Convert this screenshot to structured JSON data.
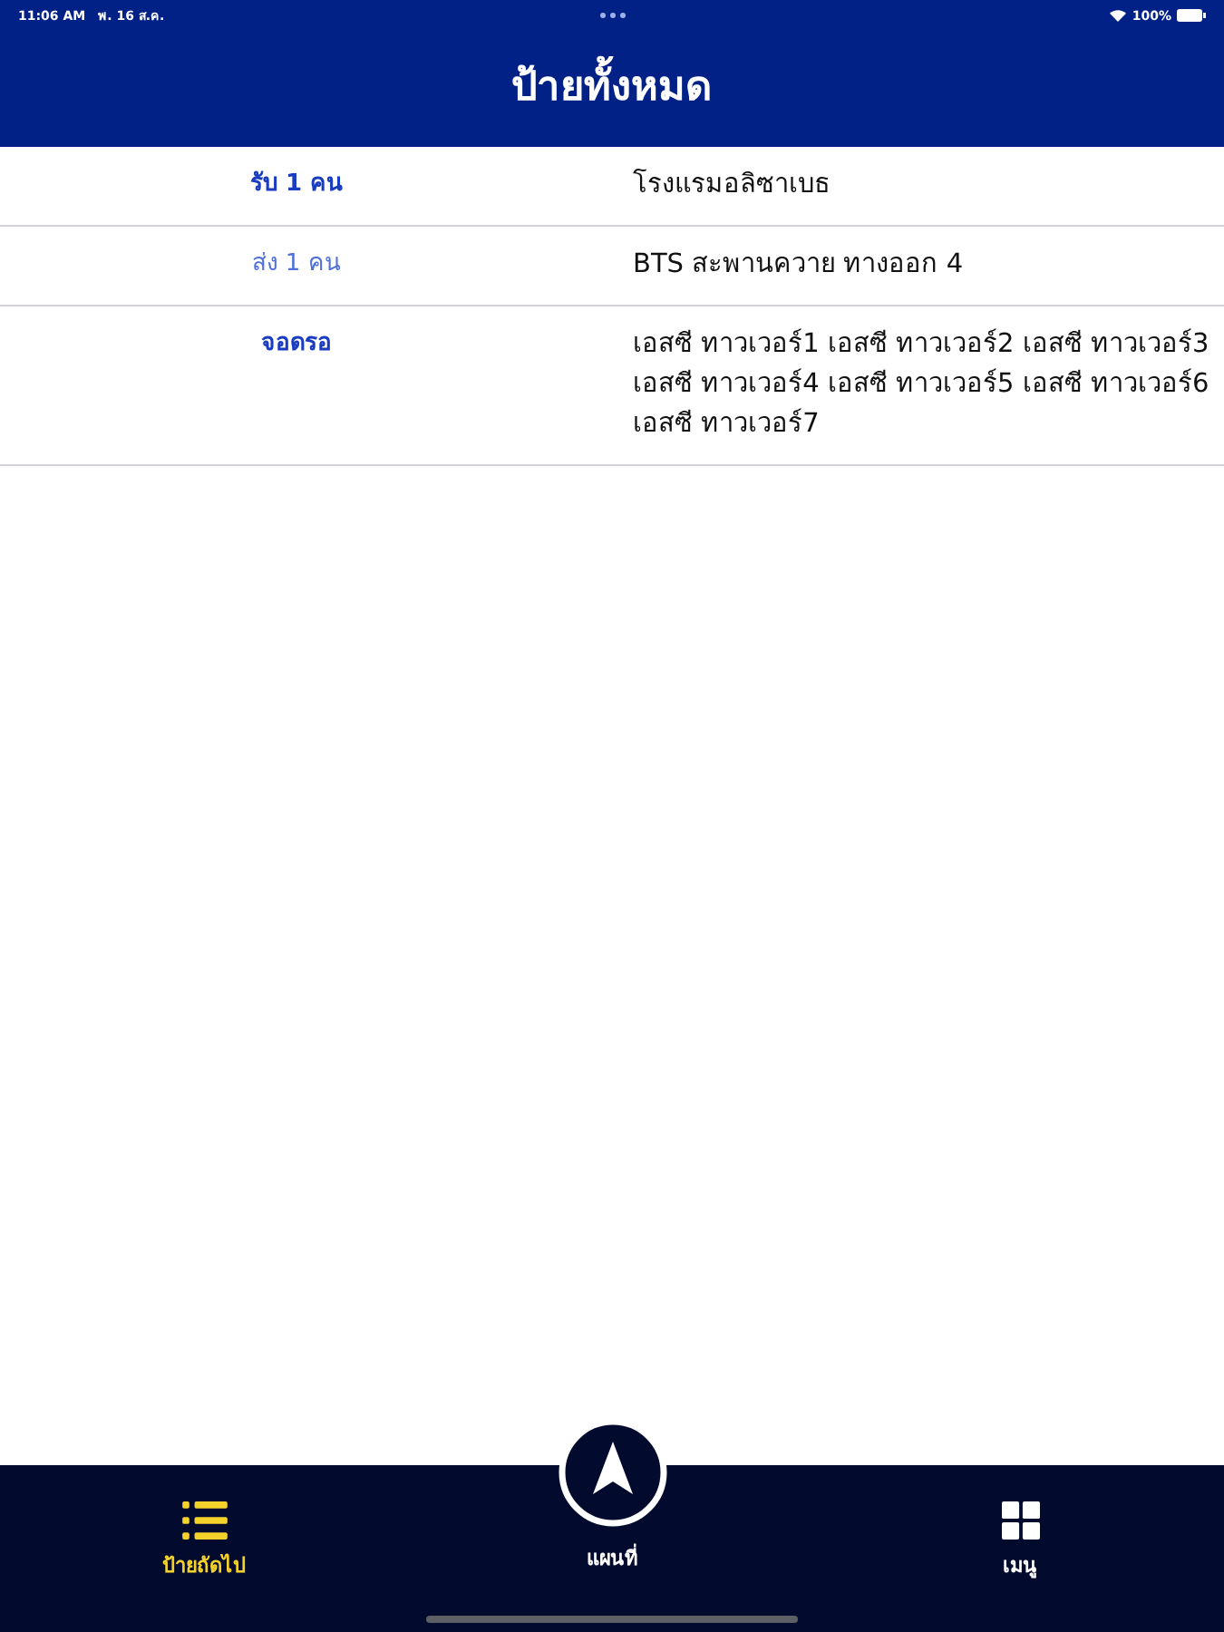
{
  "status_bar": {
    "time": "11:06 AM",
    "date": "พ. 16 ส.ค.",
    "battery_text": "100%"
  },
  "header": {
    "title": "ป้ายทั้งหมด"
  },
  "stops": [
    {
      "kind": "pickup",
      "label": "รับ 1 คน",
      "place": "โรงแรมอลิซาเบธ"
    },
    {
      "kind": "dropoff",
      "label": "ส่ง 1 คน",
      "place": "BTS สะพานควาย ทางออก 4"
    },
    {
      "kind": "wait",
      "label": "จอดรอ",
      "place": "เอสซี ทาวเวอร์1 เอสซี ทาวเวอร์2 เอสซี ทาวเวอร์3 เอสซี ทาวเวอร์4 เอสซี ทาวเวอร์5 เอสซี ทาวเวอร์6 เอสซี ทาวเวอร์7"
    }
  ],
  "tab_bar": {
    "tabs": [
      {
        "kind": "list",
        "label": "ป้ายถัดไป",
        "selected": true
      },
      {
        "kind": "map",
        "label": "แผนที่",
        "selected": false
      },
      {
        "kind": "grid",
        "label": "เมนู",
        "selected": false
      }
    ]
  }
}
